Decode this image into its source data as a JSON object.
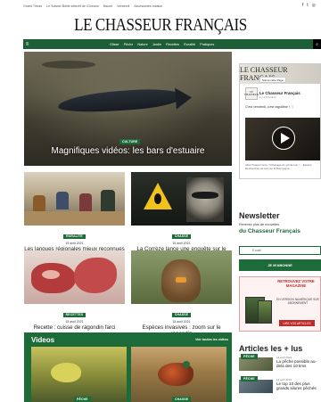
{
  "topbar": {
    "links": [
      "Grand Tétras",
      "Le Suisse/ Bellie sélectif de l'Océane",
      "Bacon",
      "Vendredi",
      "Accessoires maison"
    ]
  },
  "site": {
    "logo": "LE CHASSEUR FRANÇAIS"
  },
  "nav": {
    "items": [
      "Glisse",
      "Pêche",
      "Nature",
      "Jardin",
      "Recettes",
      "Ruralité",
      "Pratiques"
    ]
  },
  "hero": {
    "badge": "CULTURE",
    "title": "Magnifiques vidéos: les bars d'estuaire"
  },
  "articles": [
    {
      "badge": "RURALITÉ",
      "date": "15 avril 2021",
      "title": "Les langues régionales mieux reconnues dans l'enseignement"
    },
    {
      "badge": "CHASSE",
      "date": "15 avril 2021",
      "title": "La Corrèze lance une enquête sur le raton laveur"
    },
    {
      "badge": "RECETTES",
      "date": "15 avril 2021",
      "title": "Recette : cuisse de ragondin farci"
    },
    {
      "badge": "CHASSE",
      "date": "15 avril 2021",
      "title": "Espèces invasives : zoom sur le ragondin"
    }
  ],
  "videos": {
    "heading": "Videos",
    "see_all": "Voir toutes les vidéos",
    "items": [
      {
        "badge": "PÊCHE"
      },
      {
        "badge": "CHASSE"
      }
    ]
  },
  "facebook": {
    "cover_text": "LE CHASSEUR FRANÇAIS",
    "like_label": "Suivre cette Page",
    "page_name": "Le Chasseur Français",
    "followers": "il y a 5 heures",
    "post_text": "C'est vendredi, c'est ragoûtise ! 🍴",
    "caption": "Allez Poissonnerie / Chassage du printemps / ... Espèce Recherchée au sein de la Bourgogne...",
    "avatar_text": "LE CHASSEUR"
  },
  "newsletter": {
    "title": "Newsletter",
    "subtitle": "Recevez plus de nouvelles",
    "brand": "du Chasseur Français",
    "input_placeholder": "E-mail",
    "button": "JE M'ABONNE"
  },
  "ad": {
    "title": "RETROUVEZ VOTRE MAGAZINE",
    "subtitle": "EN VERSION NUMÉRIQUE SUR ABONNEMENT",
    "cta": "LIRE VOS ARTICLES"
  },
  "plus": {
    "title": "Articles les + lus",
    "items": [
      {
        "badge": "PÊCHE",
        "date": "14 avril 2021",
        "title": "La pêche possible au-delà des 10 kms"
      },
      {
        "badge": "PÊCHE",
        "date": "14 avril 2021",
        "title": "Le top 10 des plus grands silures pêchés"
      }
    ]
  }
}
